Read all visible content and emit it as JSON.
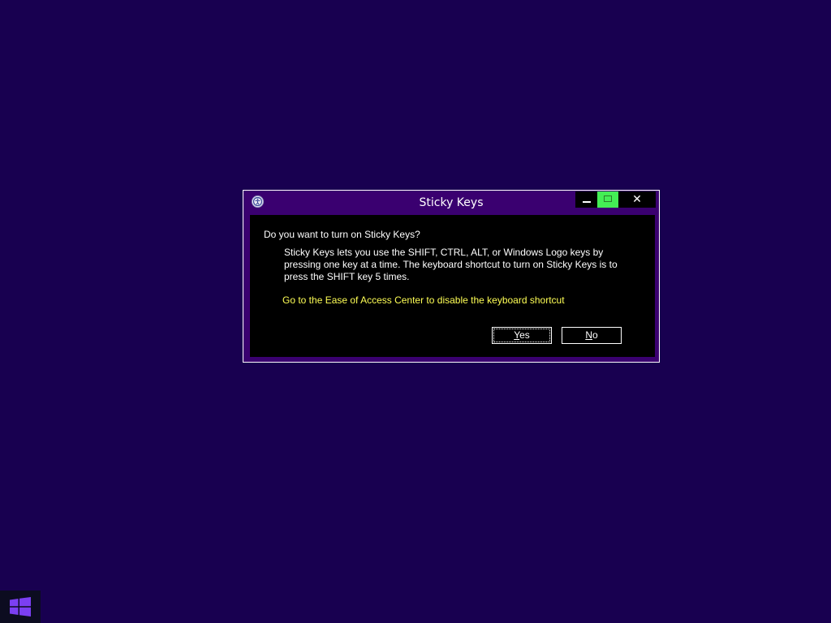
{
  "window": {
    "title": "Sticky Keys",
    "icon": "ease-of-access-icon",
    "caption_buttons": {
      "minimize_icon": "minimize-icon",
      "maximize_icon": "maximize-icon",
      "close_glyph": "✕"
    }
  },
  "dialog": {
    "question": "Do you want to turn on Sticky Keys?",
    "description": "Sticky Keys lets you use the SHIFT, CTRL, ALT, or Windows Logo keys by pressing one key at a time. The keyboard shortcut to turn on Sticky Keys is to press the SHIFT key 5 times.",
    "link": "Go to the Ease of Access Center to disable the keyboard shortcut",
    "yes_accel": "Y",
    "yes_rest": "es",
    "no_accel": "N",
    "no_rest": "o"
  },
  "taskbar": {
    "start_icon": "windows-logo-icon"
  },
  "colors": {
    "desktop": "#180050",
    "window_frame": "#3a0070",
    "link": "#ffff55",
    "maximize_highlight": "#44ee55"
  }
}
